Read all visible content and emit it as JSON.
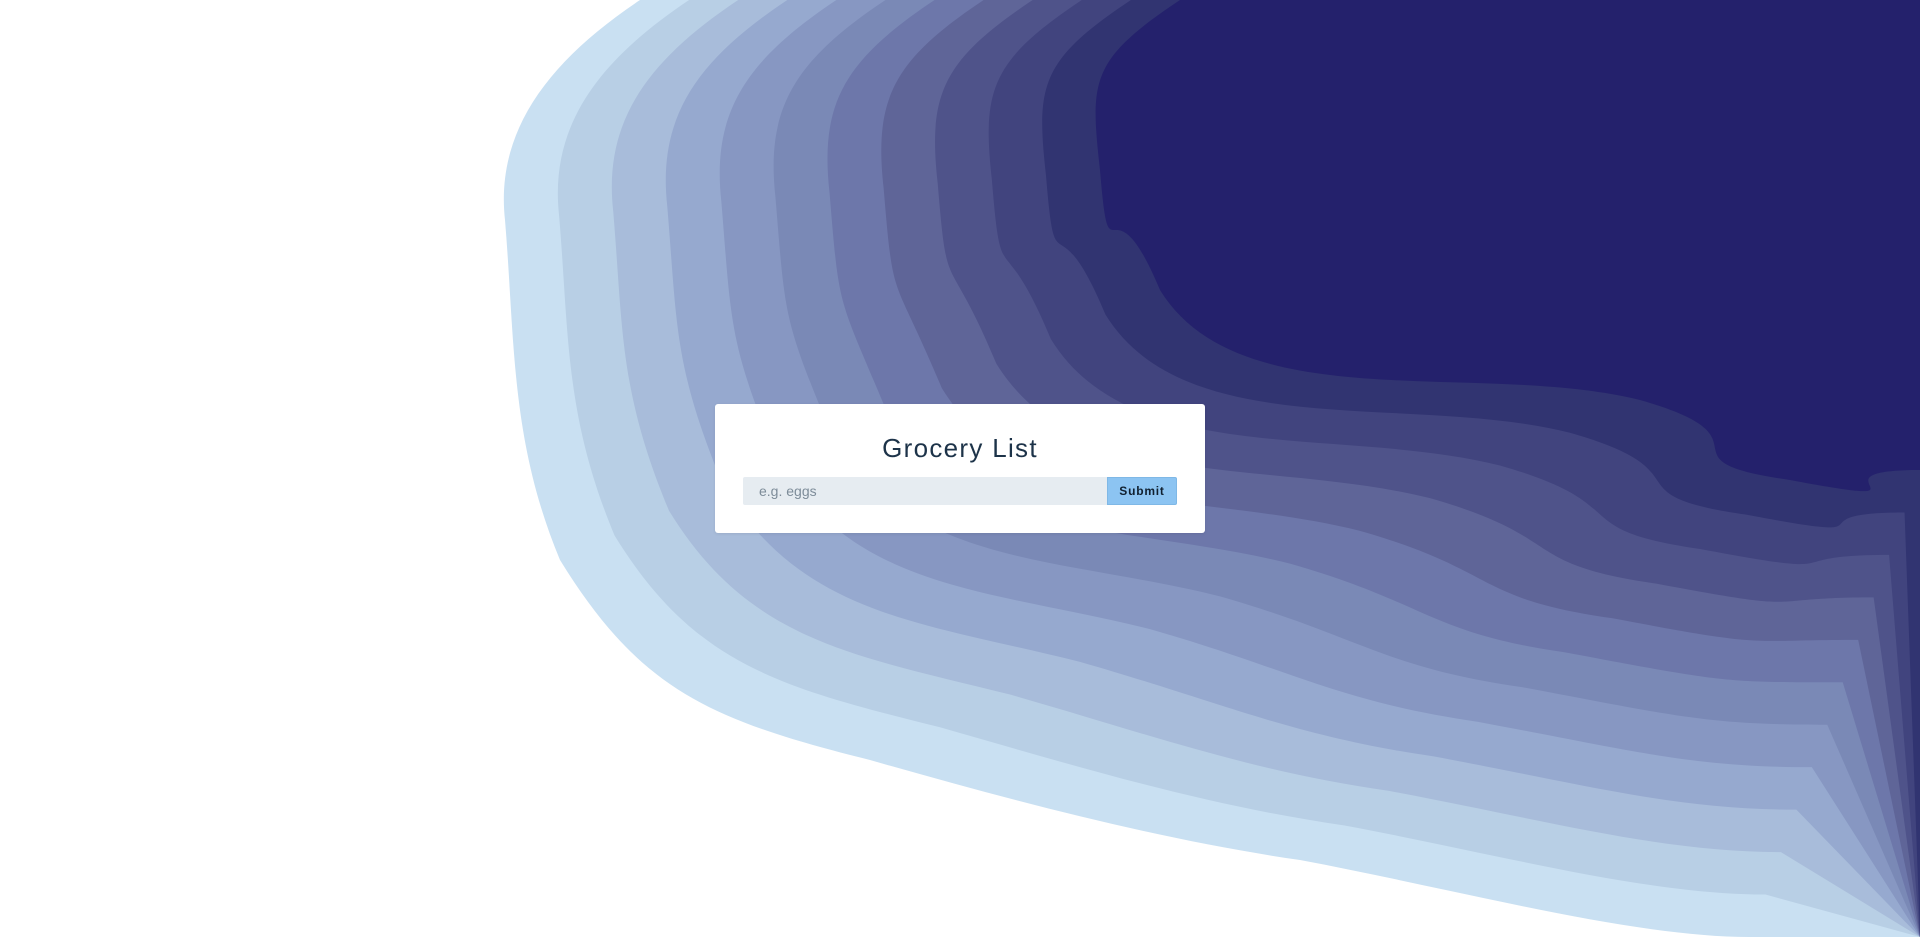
{
  "title": "Grocery List",
  "form": {
    "input_placeholder": "e.g. eggs",
    "input_value": "",
    "submit_label": "Submit"
  },
  "background": {
    "layer_colors": [
      "#c9e0f2",
      "#b8cfe5",
      "#a8bcda",
      "#96a9cf",
      "#8797c2",
      "#7a89b6",
      "#6d77aa",
      "#5f6598",
      "#4f538a",
      "#41447e",
      "#313471",
      "#24216c"
    ]
  }
}
